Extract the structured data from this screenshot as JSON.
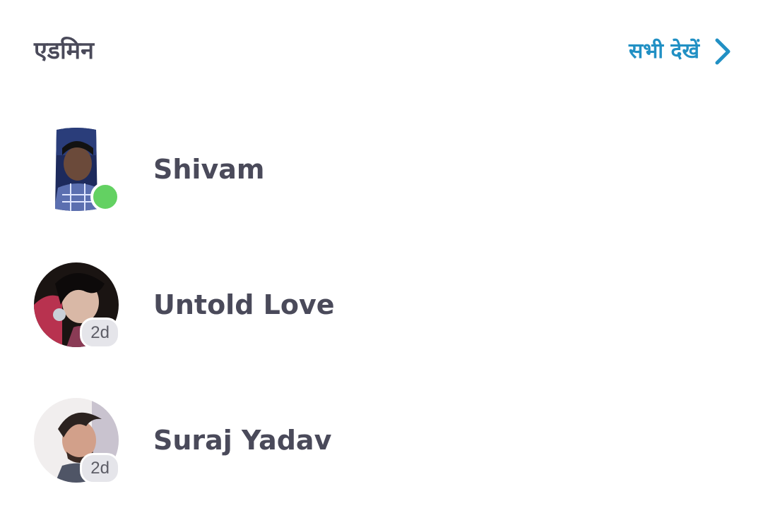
{
  "section": {
    "title": "एडमिन",
    "see_all_label": "सभी देखें",
    "accent_color": "#2190c4",
    "see_all_icon": "chevron-right-icon"
  },
  "members": [
    {
      "name": "Shivam",
      "status": "online",
      "badge": "",
      "online_color": "#63d162"
    },
    {
      "name": "Untold Love",
      "status": "time",
      "badge": "2d"
    },
    {
      "name": "Suraj Yadav",
      "status": "time",
      "badge": "2d"
    }
  ]
}
